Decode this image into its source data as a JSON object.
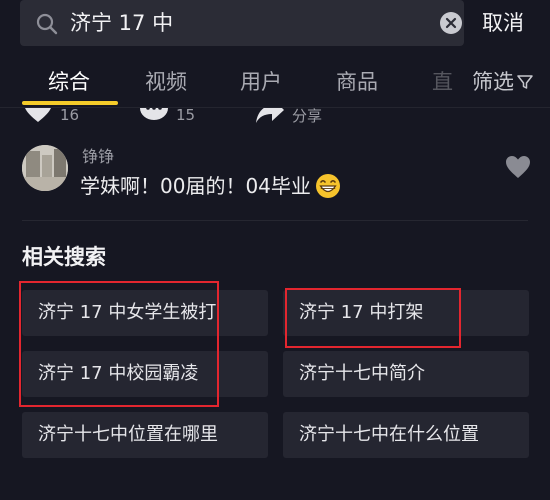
{
  "search": {
    "query": "济宁 17 中",
    "cancel_label": "取消"
  },
  "tabs": [
    {
      "label": "综合",
      "active": true
    },
    {
      "label": "视频",
      "active": false
    },
    {
      "label": "用户",
      "active": false
    },
    {
      "label": "商品",
      "active": false
    },
    {
      "label": "直",
      "active": false
    }
  ],
  "filter_label": "筛选",
  "actions": [
    {
      "icon": "like-icon",
      "count": "16"
    },
    {
      "icon": "comment-icon",
      "count": "15"
    },
    {
      "icon": "share-icon",
      "label": "分享"
    }
  ],
  "comment": {
    "author": "铮铮",
    "text": "学妹啊！00届的！04毕业",
    "emoji": "grinning-face"
  },
  "related": {
    "title": "相关搜索",
    "items": [
      "济宁 17 中女学生被打",
      "济宁 17 中打架",
      "济宁 17 中校园霸凌",
      "济宁十七中简介",
      "济宁十七中位置在哪里",
      "济宁十七中在什么位置"
    ]
  },
  "colors": {
    "background": "#161722",
    "accent_underline": "#f5cc2a",
    "highlight_box": "#e3262f"
  }
}
